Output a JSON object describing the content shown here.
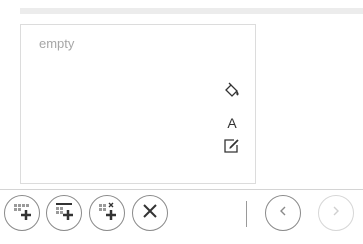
{
  "panel": {
    "empty_label": "empty",
    "tools": {
      "fill_icon": "paint-bucket-icon",
      "font_label": "A",
      "edit_icon": "edit-icon"
    }
  },
  "toolbar": {
    "buttons": [
      {
        "name": "add-row-button",
        "icon": "add-row-icon"
      },
      {
        "name": "add-row-above-button",
        "icon": "add-row-above-icon"
      },
      {
        "name": "add-row-delete-button",
        "icon": "insert-delete-row-icon"
      },
      {
        "name": "delete-button",
        "icon": "close-icon"
      },
      {
        "name": "previous-button",
        "icon": "chevron-left-icon"
      },
      {
        "name": "next-button",
        "icon": "chevron-right-icon",
        "disabled": true
      }
    ]
  },
  "colors": {
    "border": "#8a8a8a",
    "disabled_border": "#d6d6d6",
    "placeholder_text": "#a7a7a7"
  }
}
